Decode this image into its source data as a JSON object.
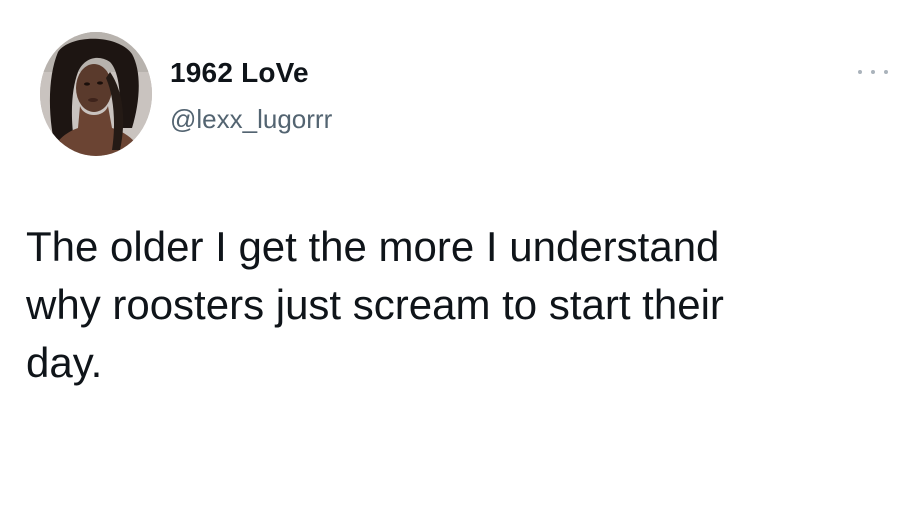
{
  "tweet": {
    "author": {
      "display_name": "1962 LoVe",
      "handle": "@lexx_lugorrr",
      "avatar_icon": "profile-photo"
    },
    "more_icon": "more-horizontal-icon",
    "text": "The older I get the more I understand\nwhy roosters just scream to start their\nday."
  },
  "colors": {
    "text_primary": "#0f1419",
    "text_secondary": "#536471",
    "background": "#ffffff"
  }
}
